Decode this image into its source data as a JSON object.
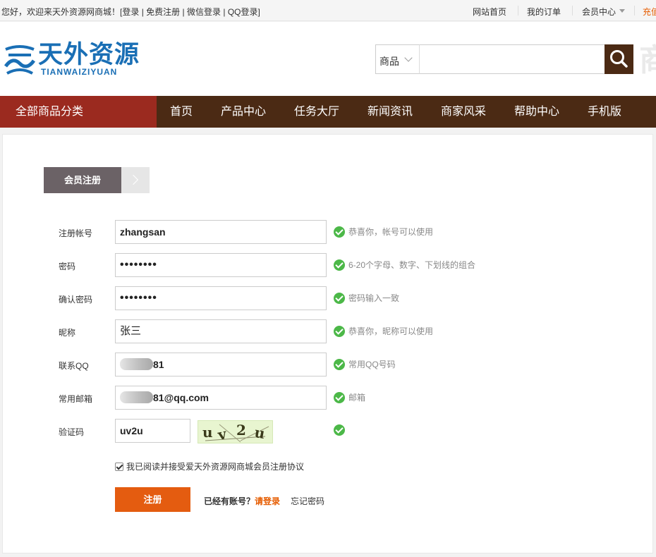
{
  "topbar": {
    "welcome": "您好，欢迎来天外资源网商城！",
    "login": "[登录",
    "register": "免费注册",
    "wechat_login": "微信登录",
    "qq_login": "QQ登录]",
    "sep": "|",
    "home": "网站首页",
    "orders": "我的订单",
    "member_center": "会员中心",
    "recharge": "充值"
  },
  "header": {
    "logo_cn": "天外资源",
    "logo_en": "TIANWAIZIYUAN",
    "search_category": "商品",
    "search_placeholder": "",
    "ghost_text": "商"
  },
  "nav": {
    "all_categories": "全部商品分类",
    "items": [
      "首页",
      "产品中心",
      "任务大厅",
      "新闻资讯",
      "商家风采",
      "帮助中心",
      "手机版"
    ]
  },
  "form": {
    "tab_title": "会员注册",
    "rows": [
      {
        "label": "注册帐号",
        "value": "zhangsan",
        "hint": "恭喜你，帐号可以使用"
      },
      {
        "label": "密码",
        "value": "••••••••",
        "hint": "6-20个字母、数字、下划线的组合"
      },
      {
        "label": "确认密码",
        "value": "••••••••",
        "hint": "密码输入一致"
      },
      {
        "label": "昵称",
        "value": "张三",
        "hint": "恭喜你，昵称可以使用"
      },
      {
        "label": "联系QQ",
        "value": "81",
        "hint": "常用QQ号码"
      },
      {
        "label": "常用邮箱",
        "value": "81@qq.com",
        "hint": "邮箱"
      },
      {
        "label": "验证码",
        "value": "uv2u",
        "hint": ""
      }
    ],
    "captcha_text": "uv2u",
    "agree_text": "我已阅读并接受爱天外资源网商城会员注册协议",
    "agree_checked": true,
    "submit": "注册",
    "has_account": "已经有账号？",
    "login_link": "请登录",
    "forgot": "忘记密码"
  },
  "colors": {
    "nav_bg": "#4b2a14",
    "category_bg": "#9b2a1f",
    "submit_bg": "#e45c10",
    "ok_green": "#4cb848",
    "logo_blue": "#1a6fb5"
  }
}
